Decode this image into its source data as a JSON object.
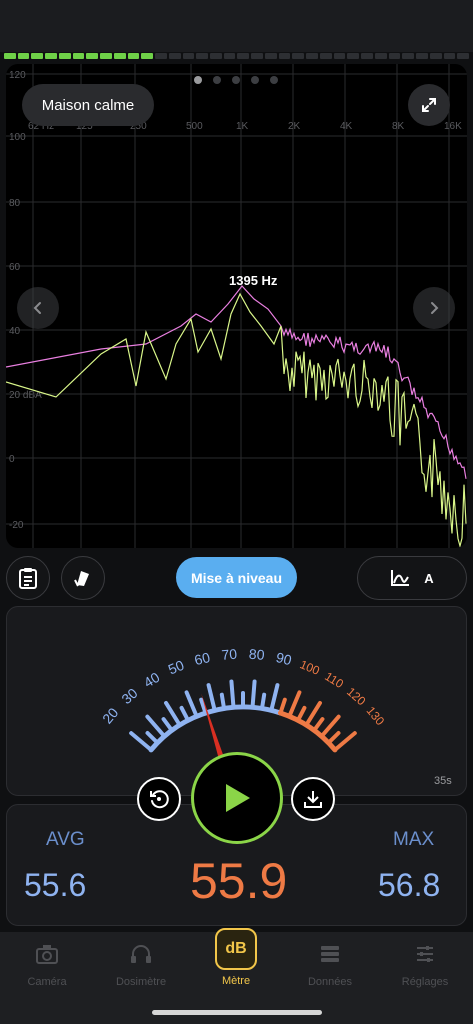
{
  "spectrum": {
    "preset_label": "Maison calme",
    "peak_label": "1395 Hz",
    "y_ticks": [
      "120",
      "100",
      "80",
      "60",
      "40",
      "20 dBA",
      "0",
      "-20"
    ],
    "x_ticks": [
      "62 Hz",
      "125",
      "250",
      "500",
      "1K",
      "2K",
      "4K",
      "8K",
      "16K"
    ],
    "page_count": 5,
    "active_page": 1
  },
  "toolbar": {
    "upgrade_label": "Mise à niveau",
    "weighting_label": "A"
  },
  "meter": {
    "scale_blue": [
      "20",
      "30",
      "40",
      "50",
      "60",
      "70",
      "80",
      "90"
    ],
    "scale_orange": [
      "100",
      "110",
      "120",
      "130"
    ],
    "needle_db": 55.9,
    "timer_label": "35s"
  },
  "stats": {
    "avg_label": "AVG",
    "avg_value": "55.6",
    "current_value": "55.9",
    "max_label": "MAX",
    "max_value": "56.8"
  },
  "tabs": [
    {
      "label": "Caméra",
      "icon": "camera-icon"
    },
    {
      "label": "Dosimètre",
      "icon": "headphones-icon"
    },
    {
      "label": "Mètre",
      "icon": "db-meter-icon",
      "badge": "dB"
    },
    {
      "label": "Données",
      "icon": "database-icon"
    },
    {
      "label": "Réglages",
      "icon": "sliders-icon"
    }
  ],
  "colors": {
    "accent_green": "#8bd548",
    "upgrade_blue": "#5aaef0",
    "scale_blue": "#8fb3f0",
    "scale_orange": "#ee7a45",
    "needle_red": "#d92f22",
    "active_tab": "#f2c64a",
    "curve_pink": "#e97fe0",
    "curve_yellow": "#d9f68a"
  }
}
